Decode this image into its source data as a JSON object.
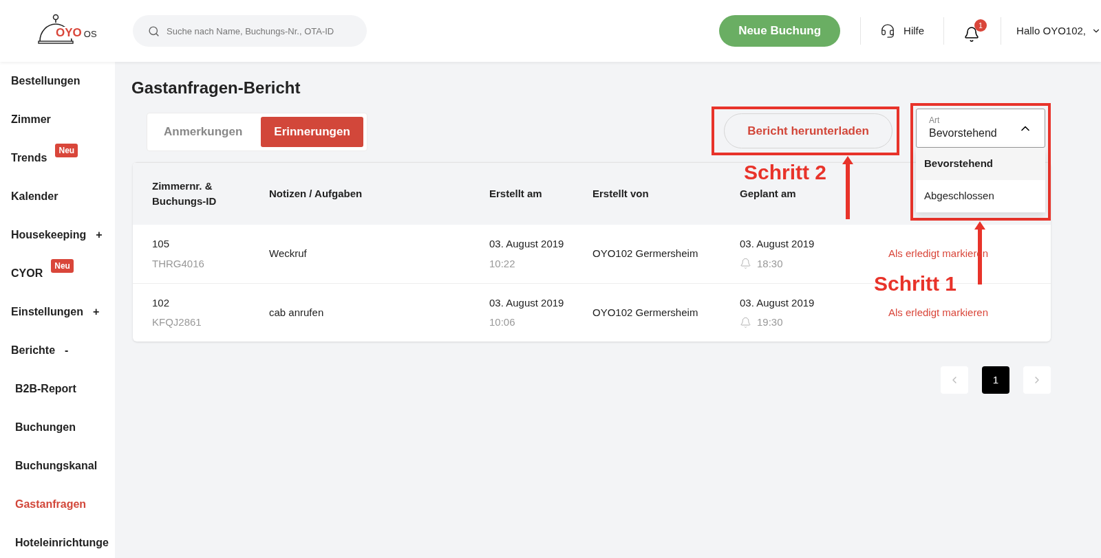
{
  "header": {
    "logo": {
      "brand": "OYO",
      "suffix": "OS"
    },
    "search": {
      "placeholder": "Suche nach Name, Buchungs-Nr., OTA-ID"
    },
    "new_booking": "Neue Buchung",
    "help": "Hilfe",
    "notifications": {
      "count": "1"
    },
    "user": "Hallo OYO102,"
  },
  "sidebar": {
    "items": [
      {
        "label": "Bestellungen",
        "selected": false
      },
      {
        "label": "Zimmer",
        "selected": false
      },
      {
        "label": "Trends",
        "badge": "Neu",
        "selected": false
      },
      {
        "label": "Kalender",
        "selected": false
      },
      {
        "label": "Housekeeping",
        "toggle": "+",
        "selected": false
      },
      {
        "label": "CYOR",
        "badge": "Neu",
        "selected": false
      },
      {
        "label": "Einstellungen",
        "toggle": "+",
        "selected": false
      },
      {
        "label": "Berichte",
        "toggle": "-",
        "selected": false,
        "children": [
          {
            "label": "B2B-Report",
            "selected": false
          },
          {
            "label": "Buchungen",
            "selected": false
          },
          {
            "label": "Buchungskanal",
            "selected": false
          },
          {
            "label": "Gastanfragen",
            "selected": true
          },
          {
            "label": "Hoteleinrichtunge",
            "selected": false
          }
        ]
      }
    ]
  },
  "page": {
    "title": "Gastanfragen-Bericht",
    "tabs": [
      {
        "label": "Anmerkungen",
        "selected": false
      },
      {
        "label": "Erinnerungen",
        "selected": true
      }
    ],
    "download": "Bericht herunterladen",
    "type_select": {
      "label": "Art",
      "value": "Bevorstehend",
      "expanded": true,
      "options": [
        {
          "label": "Bevorstehend",
          "selected": true
        },
        {
          "label": "Abgeschlossen",
          "selected": false
        }
      ]
    },
    "table": {
      "columns": [
        "Zimmernr. & Buchungs-ID",
        "Notizen / Aufgaben",
        "Erstellt am",
        "Erstellt von",
        "Geplant am"
      ],
      "rows": [
        {
          "room": "105",
          "booking_id": "THRG4016",
          "note": "Weckruf",
          "created_date": "03. August 2019",
          "created_time": "10:22",
          "created_by": "OYO102 Germersheim",
          "planned_date": "03. August 2019",
          "planned_time": "18:30",
          "action": "Als erledigt markieren"
        },
        {
          "room": "102",
          "booking_id": "KFQJ2861",
          "note": "cab anrufen",
          "created_date": "03. August 2019",
          "created_time": "10:06",
          "created_by": "OYO102 Germersheim",
          "planned_date": "03. August 2019",
          "planned_time": "19:30",
          "action": "Als erledigt markieren"
        }
      ]
    },
    "pagination": {
      "pages": [
        {
          "label": "1",
          "selected": true
        }
      ]
    }
  },
  "annotations": [
    {
      "kind": "step",
      "text": "Schritt 2"
    },
    {
      "kind": "step",
      "text": "Schritt 1"
    }
  ]
}
